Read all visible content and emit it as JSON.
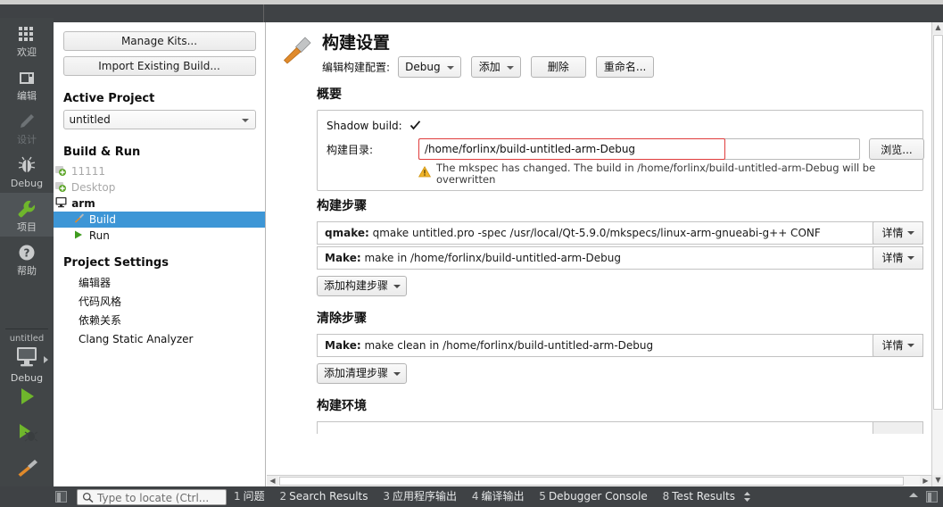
{
  "modebar": {
    "items": [
      {
        "label": "欢迎",
        "icon": "grid-icon",
        "state": "normal"
      },
      {
        "label": "编辑",
        "icon": "editor-icon",
        "state": "normal"
      },
      {
        "label": "设计",
        "icon": "pencil-icon",
        "state": "disabled"
      },
      {
        "label": "Debug",
        "icon": "bug-icon",
        "state": "normal"
      },
      {
        "label": "项目",
        "icon": "wrench-icon",
        "state": "active"
      },
      {
        "label": "帮助",
        "icon": "help-icon",
        "state": "normal"
      }
    ],
    "run_selector": {
      "project": "untitled",
      "kit_icon": "desktop-icon",
      "config": "Debug"
    },
    "actions": [
      {
        "name": "run-button",
        "icon": "play-icon"
      },
      {
        "name": "debug-button",
        "icon": "play-bug-icon"
      },
      {
        "name": "build-button",
        "icon": "hammer-icon"
      }
    ]
  },
  "project_panel": {
    "manage_kits_label": "Manage Kits...",
    "import_build_label": "Import Existing Build...",
    "active_project_heading": "Active Project",
    "active_project_value": "untitled",
    "build_run_heading": "Build & Run",
    "tree": [
      {
        "label": "11111",
        "icon": "kit-warning-icon",
        "level": 0,
        "dim": true,
        "bold": false,
        "selected": false
      },
      {
        "label": "Desktop",
        "icon": "kit-warning-icon",
        "level": 0,
        "dim": true,
        "bold": false,
        "selected": false
      },
      {
        "label": "arm",
        "icon": "desktop-icon",
        "level": 0,
        "dim": false,
        "bold": true,
        "selected": false
      },
      {
        "label": "Build",
        "icon": "hammer-icon",
        "level": 1,
        "dim": false,
        "bold": false,
        "selected": true
      },
      {
        "label": "Run",
        "icon": "play-icon",
        "level": 1,
        "dim": false,
        "bold": false,
        "selected": false
      }
    ],
    "project_settings_heading": "Project Settings",
    "settings": [
      {
        "label": "编辑器"
      },
      {
        "label": "代码风格"
      },
      {
        "label": "依赖关系"
      },
      {
        "label": "Clang Static Analyzer"
      }
    ]
  },
  "main": {
    "title": "构建设置",
    "title_icon": "hammer-icon",
    "edit_config_label": "编辑构建配置:",
    "config_value": "Debug",
    "add_label": "添加",
    "remove_label": "删除",
    "rename_label": "重命名...",
    "summary_heading": "概要",
    "shadow_build_label": "Shadow build:",
    "shadow_build_checked": "✔",
    "build_dir_label": "构建目录:",
    "build_dir_value": "/home/forlinx/build-untitled-arm-Debug",
    "browse_label": "浏览...",
    "warning_text": "The mkspec has changed. The build in /home/forlinx/build-untitled-arm-Debug will be overwritten",
    "build_steps_heading": "构建步骤",
    "build_steps": [
      {
        "name": "qmake:",
        "desc": "qmake untitled.pro -spec /usr/local/Qt-5.9.0/mkspecs/linux-arm-gnueabi-g++ CONF",
        "detail_label": "详情"
      },
      {
        "name": "Make:",
        "desc": "make in /home/forlinx/build-untitled-arm-Debug",
        "detail_label": "详情"
      }
    ],
    "add_build_step_label": "添加构建步骤",
    "clean_steps_heading": "清除步骤",
    "clean_steps": [
      {
        "name": "Make:",
        "desc": "make clean in /home/forlinx/build-untitled-arm-Debug",
        "detail_label": "详情"
      }
    ],
    "add_clean_step_label": "添加清理步骤",
    "build_env_heading": "构建环境"
  },
  "statusbar": {
    "locator_placeholder": "Type to locate (Ctrl...",
    "tabs": [
      {
        "num": "1",
        "name": "问题"
      },
      {
        "num": "2",
        "name": "Search Results"
      },
      {
        "num": "3",
        "name": "应用程序输出"
      },
      {
        "num": "4",
        "name": "编译输出"
      },
      {
        "num": "5",
        "name": "Debugger Console"
      },
      {
        "num": "8",
        "name": "Test Results"
      }
    ]
  },
  "colors": {
    "modebar_bg": "#414547",
    "modebar_active": "#4f5457",
    "selection_blue": "#3d96d6",
    "accent_green": "#6fb62c",
    "warning_orange": "#e6a817",
    "focus_red": "#e03c3c",
    "statusbar_bg": "#3f4245"
  }
}
